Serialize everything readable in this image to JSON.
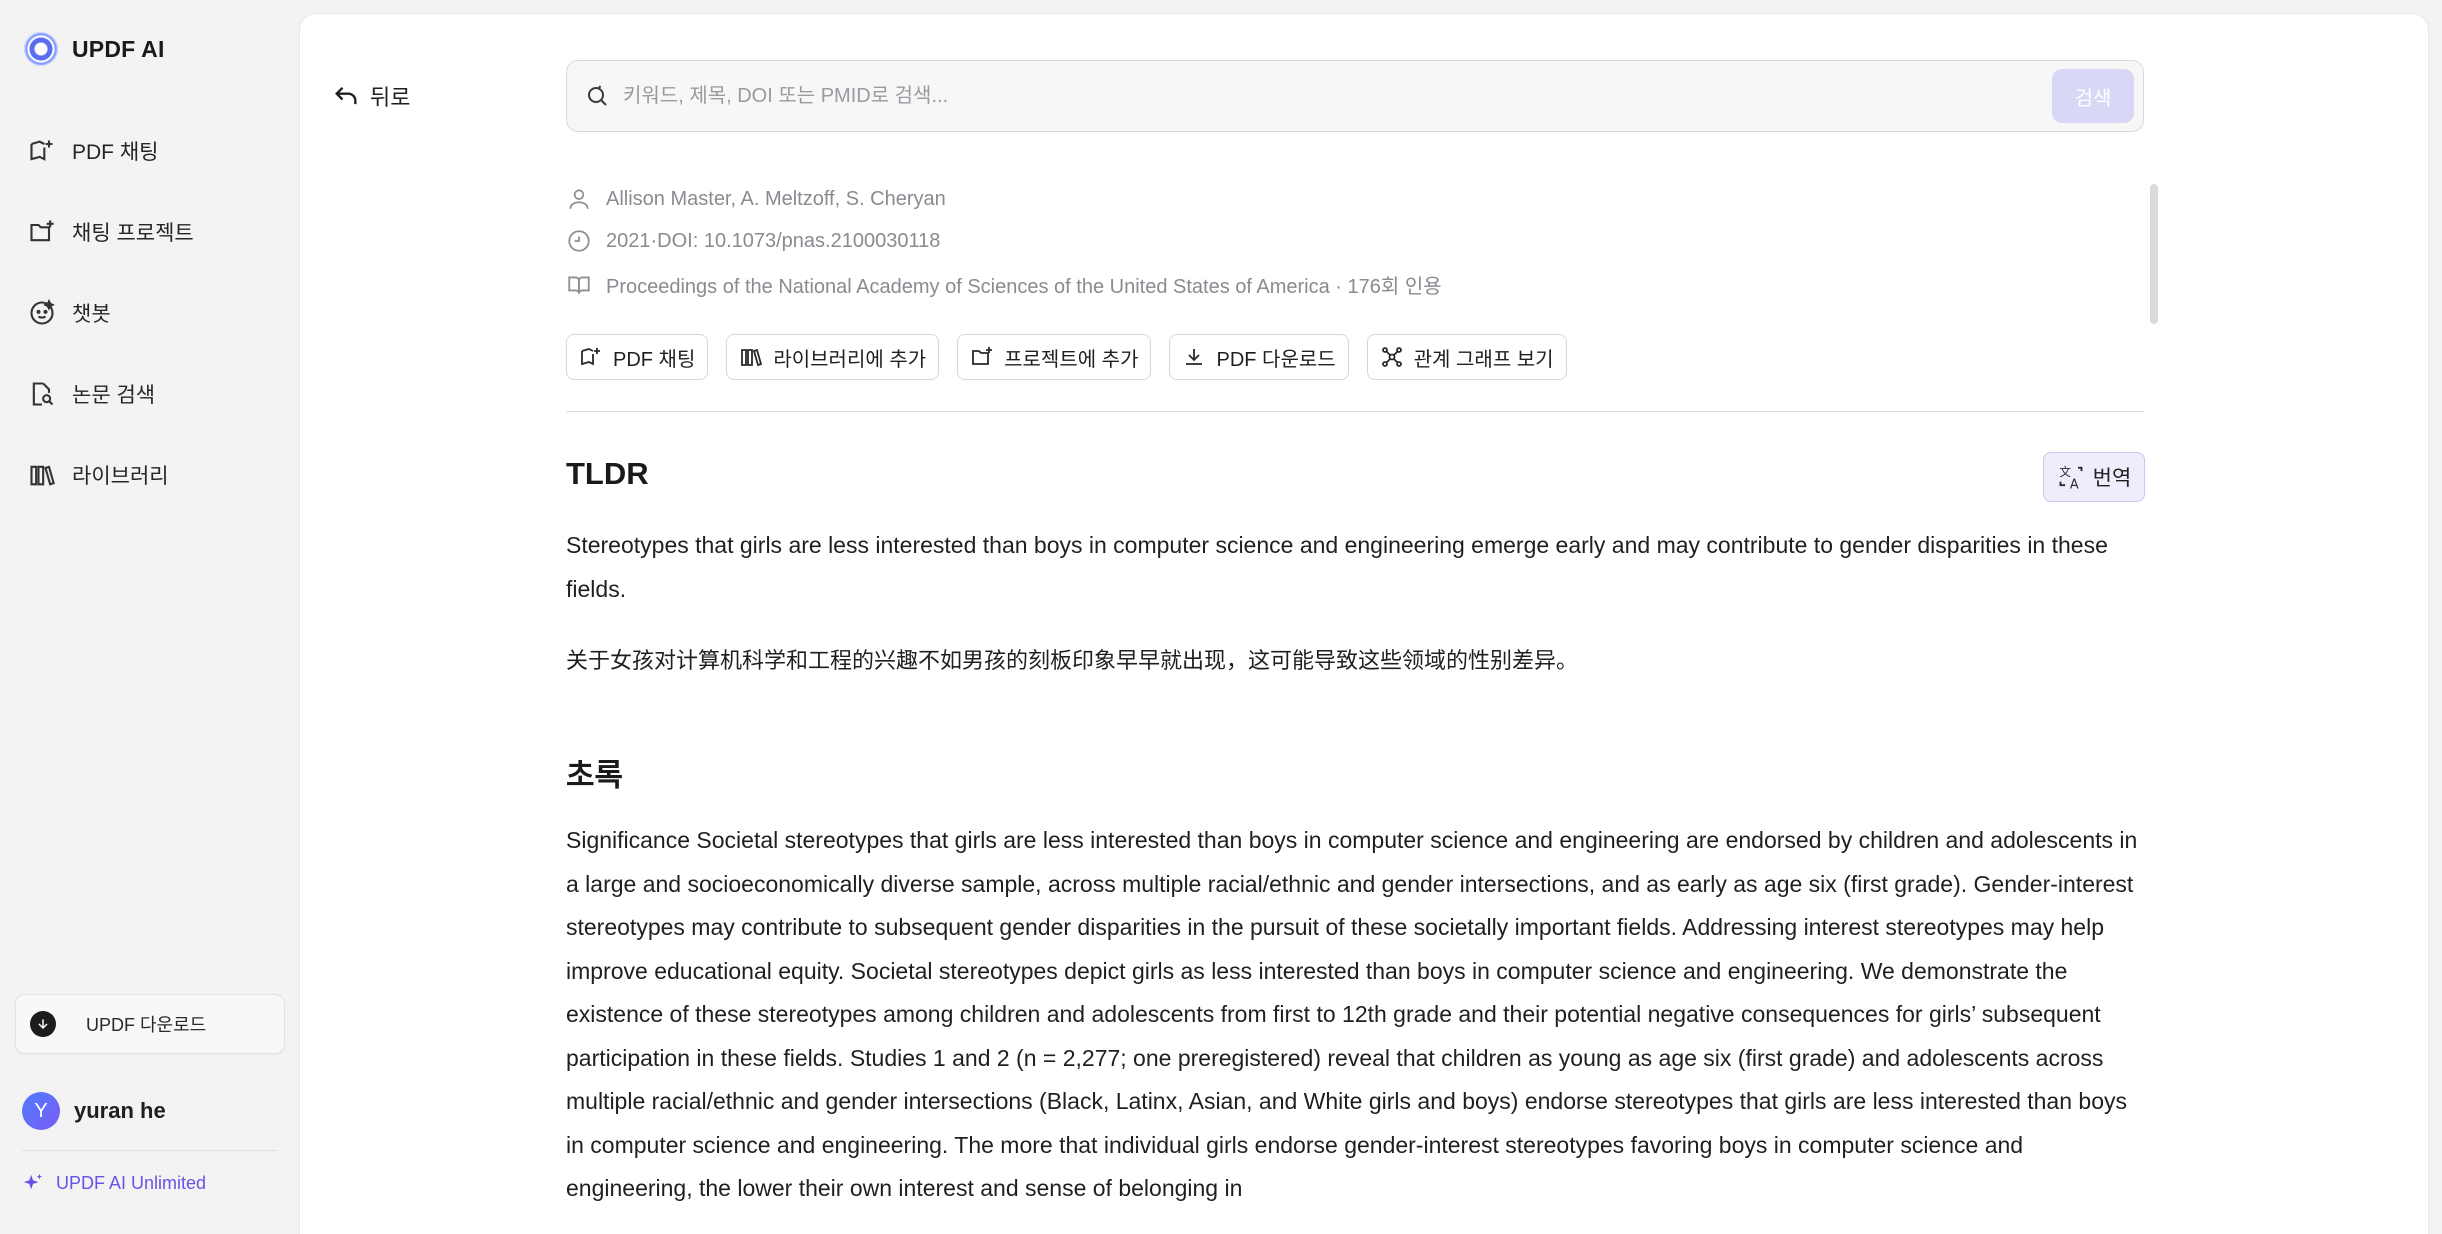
{
  "sidebar": {
    "brand": "UPDF AI",
    "items": [
      {
        "label": "PDF 채팅",
        "icon": "book-plus-icon"
      },
      {
        "label": "채팅 프로젝트",
        "icon": "folder-plus-icon"
      },
      {
        "label": "챗봇",
        "icon": "bot-face-icon"
      },
      {
        "label": "논문 검색",
        "icon": "document-search-icon"
      },
      {
        "label": "라이브러리",
        "icon": "library-icon"
      }
    ],
    "download_label": "UPDF 다운로드",
    "user": {
      "initial": "Y",
      "name": "yuran he"
    },
    "plan_label": "UPDF AI Unlimited"
  },
  "main": {
    "back_label": "뒤로",
    "search": {
      "placeholder": "키워드, 제목, DOI 또는 PMID로 검색...",
      "value": "",
      "button": "검색"
    },
    "paper": {
      "authors": "Allison Master,  A. Meltzoff,  S. Cheryan",
      "year_doi": "2021·DOI: 10.1073/pnas.2100030118",
      "venue": "Proceedings of the National Academy of Sciences of the United States of America · 176회 인용"
    },
    "actions": [
      {
        "label": "PDF 채팅",
        "icon": "book-plus-icon"
      },
      {
        "label": "라이브러리에 추가",
        "icon": "library-icon"
      },
      {
        "label": "프로젝트에 추가",
        "icon": "folder-plus-icon"
      },
      {
        "label": "PDF 다운로드",
        "icon": "download-icon"
      },
      {
        "label": "관계 그래프 보기",
        "icon": "graph-icon"
      }
    ],
    "tldr": {
      "heading": "TLDR",
      "translate_label": "번역",
      "text_en": "Stereotypes that girls are less interested than boys in computer science and engineering emerge early and may contribute to gender disparities in these fields.",
      "text_zh": "关于女孩对计算机科学和工程的兴趣不如男孩的刻板印象早早就出现，这可能导致这些领域的性别差异。"
    },
    "abstract": {
      "heading": "초록",
      "text": "Significance Societal stereotypes that girls are less interested than boys in computer science and engineering are endorsed by children and adolescents in a large and socioeconomically diverse sample, across multiple racial/ethnic and gender intersections, and as early as age six (first grade). Gender-interest stereotypes may contribute to subsequent gender disparities in the pursuit of these societally important fields. Addressing interest stereotypes may help improve educational equity. Societal stereotypes depict girls as less interested than boys in computer science and engineering. We demonstrate the existence of these stereotypes among children and adolescents from first to 12th grade and their potential negative consequences for girls’ subsequent participation in these fields. Studies 1 and 2 (n = 2,277; one preregistered) reveal that children as young as age six (first grade) and adolescents across multiple racial/ethnic and gender intersections (Black, Latinx, Asian, and White girls and boys) endorse stereotypes that girls are less interested than boys in computer science and engineering. The more that individual girls endorse gender-interest stereotypes favoring boys in computer science and engineering, the lower their own interest and sense of belonging in"
    }
  },
  "colors": {
    "accent": "#6654e8",
    "search_button_bg": "#d8d8f6",
    "translate_bg": "#ededfc"
  }
}
